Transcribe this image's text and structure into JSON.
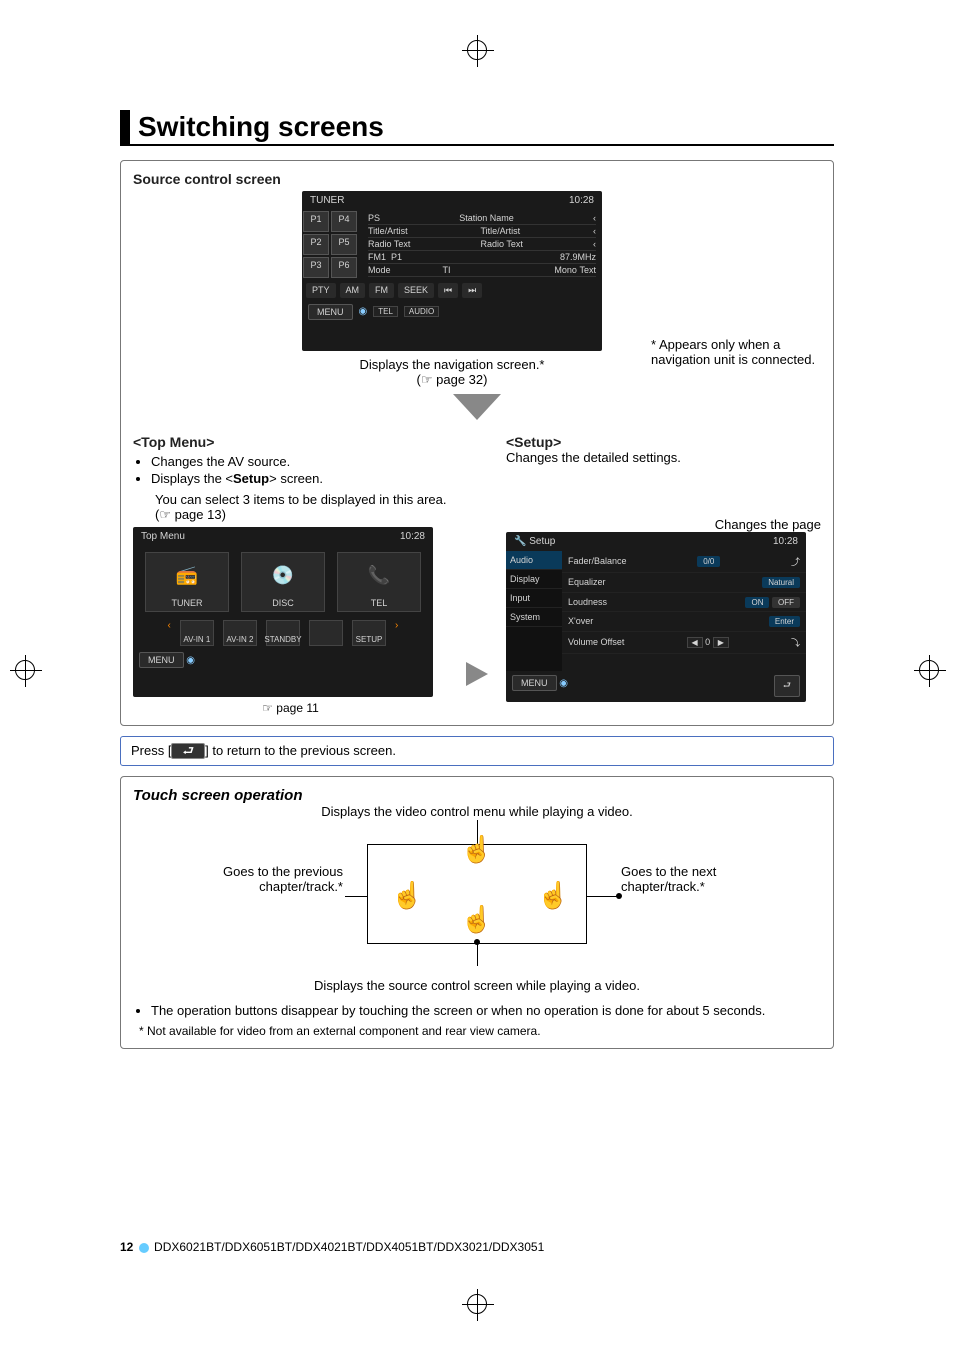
{
  "page_title": "Switching screens",
  "source_control": {
    "heading": "Source control screen",
    "tuner": {
      "title": "TUNER",
      "clock": "10:28",
      "presets": [
        "P1",
        "P4",
        "P2",
        "P5",
        "P3",
        "P6"
      ],
      "rows": [
        {
          "k": "PS",
          "v": "Station Name"
        },
        {
          "k": "Title/Artist",
          "v": "Title/Artist"
        },
        {
          "k": "Radio Text",
          "v": "Radio Text"
        }
      ],
      "band": "FM1",
      "preset_sel": "P1",
      "freq": "87.9MHz",
      "mode_row": [
        "Mode",
        "TI",
        "Mono",
        "Text"
      ],
      "btn_row": [
        "PTY",
        "AM",
        "FM",
        "SEEK",
        "⏮",
        "⏭"
      ],
      "menu_label": "MENU",
      "sub_buttons": [
        "TEL",
        "AUDIO"
      ]
    },
    "caption_line1": "Displays the navigation screen.*",
    "caption_line2": "(☞ page 32)",
    "note_star": "*",
    "note_text": "Appears only when a navigation unit is connected."
  },
  "top_menu": {
    "heading": "<Top Menu>",
    "bullets": [
      "Changes the AV source.",
      "Displays the <Setup> screen."
    ],
    "hint": "You can select 3 items to be displayed in this area. (☞ page 13)",
    "shot": {
      "title": "Top Menu",
      "clock": "10:28",
      "tiles": [
        "TUNER",
        "DISC",
        "TEL"
      ],
      "chips": [
        "AV-IN 1",
        "AV-IN 2",
        "STANDBY",
        "",
        "SETUP"
      ],
      "menu_label": "MENU"
    },
    "page_ref": "☞ page 11"
  },
  "setup": {
    "heading": "<Setup>",
    "desc": "Changes the detailed settings.",
    "page_label": "Changes the page",
    "shot": {
      "title": "Setup",
      "clock": "10:28",
      "nav": [
        "Audio",
        "Display",
        "Input",
        "System"
      ],
      "rows": [
        {
          "label": "Fader/Balance",
          "val": "0/0"
        },
        {
          "label": "Equalizer",
          "val": "Natural"
        },
        {
          "label": "Loudness",
          "val_on": "ON",
          "val_off": "OFF"
        },
        {
          "label": "X'over",
          "val": "Enter"
        },
        {
          "label": "Volume Offset",
          "val": "0"
        }
      ],
      "menu_label": "MENU"
    }
  },
  "press_row": {
    "prefix": "Press [",
    "icon": "⮐",
    "suffix": "] to return to the previous screen."
  },
  "touch": {
    "heading": "Touch screen operation",
    "top": "Displays the video control menu while playing a video.",
    "left": "Goes to the previous chapter/track.*",
    "right": "Goes to the next chapter/track.*",
    "bottom": "Displays the source control screen while playing a video.",
    "bullet": "The operation buttons disappear by touching the screen or when no operation is done for about 5 seconds.",
    "foot_star": "*",
    "foot": "Not available for video from an external component and rear view camera."
  },
  "footer": {
    "page_num": "12",
    "models": "DDX6021BT/DDX6051BT/DDX4021BT/DDX4051BT/DDX3021/DDX3051"
  }
}
